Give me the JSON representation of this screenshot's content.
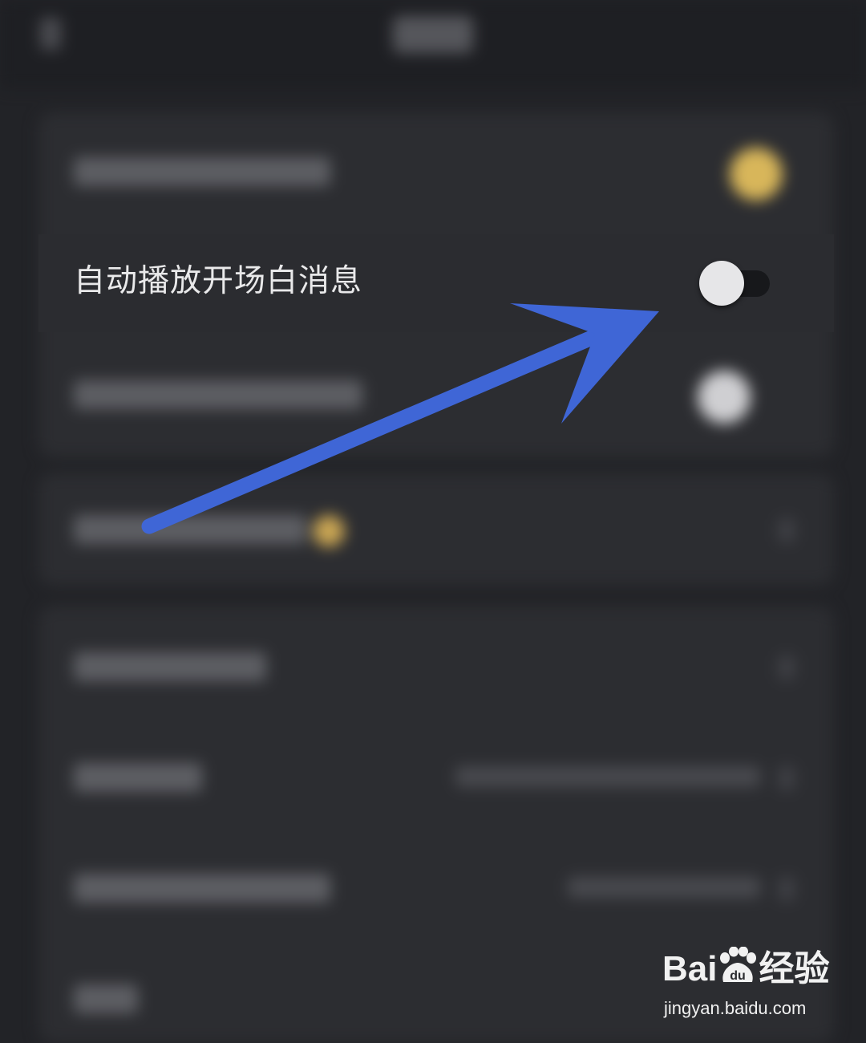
{
  "setting": {
    "label": "自动播放开场白消息",
    "enabled": false
  },
  "icons": {
    "back": "chevron-left-icon",
    "arrow": "annotation-arrow",
    "watermark_paw": "paw-icon"
  },
  "colors": {
    "background": "#222327",
    "card": "#2c2d31",
    "arrow": "#3f66d6",
    "toggle_knob": "#e6e6e8",
    "toggle_track": "#17181b",
    "accent_gold": "#d8b65a"
  },
  "watermark": {
    "logo_text_left": "Bai",
    "logo_text_right": "经验",
    "paw_text": "du",
    "url": "jingyan.baidu.com"
  }
}
